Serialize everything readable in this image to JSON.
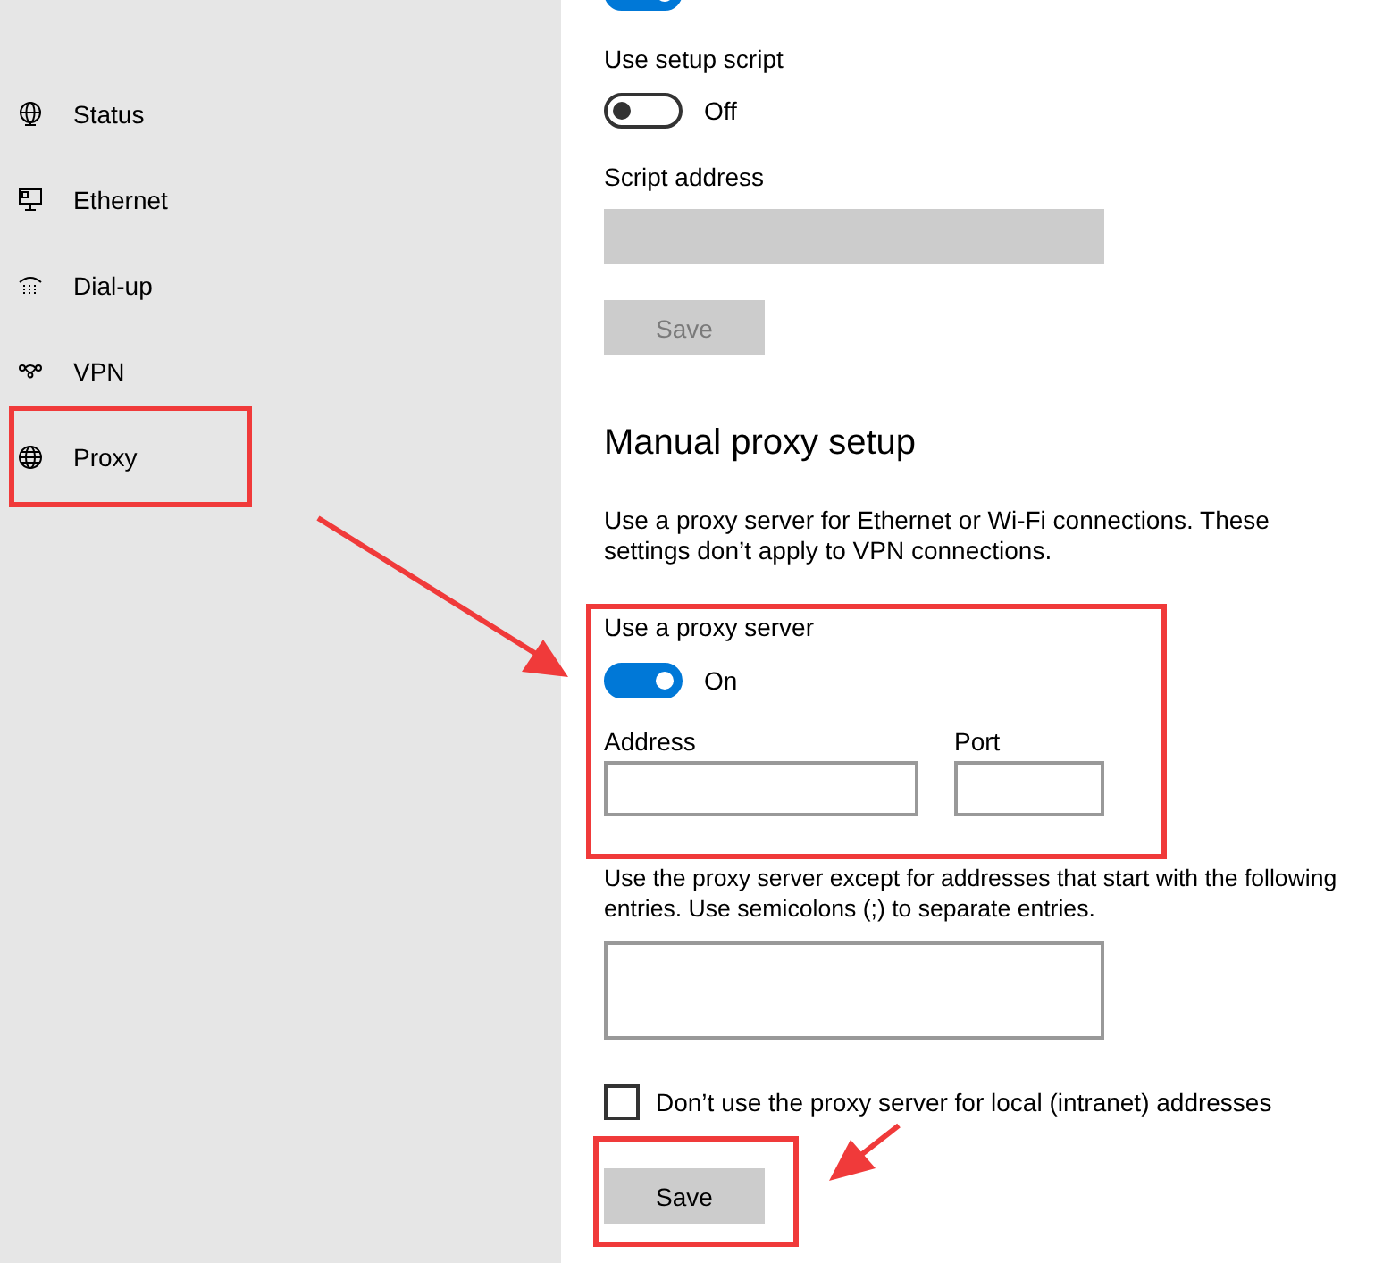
{
  "sidebar": {
    "items": [
      {
        "kind": "status",
        "label": "Status"
      },
      {
        "kind": "ethernet",
        "label": "Ethernet"
      },
      {
        "kind": "dialup",
        "label": "Dial-up"
      },
      {
        "kind": "vpn",
        "label": "VPN"
      },
      {
        "kind": "proxy",
        "label": "Proxy"
      }
    ]
  },
  "automatic": {
    "detect_toggle": {
      "on": true
    },
    "setup_script": {
      "label": "Use setup script",
      "on": false,
      "state_text": "Off"
    },
    "script_address": {
      "label": "Script address",
      "disabled": true
    },
    "save": {
      "label": "Save",
      "disabled": true
    }
  },
  "manual": {
    "heading": "Manual proxy setup",
    "description": "Use a proxy server for Ethernet or Wi-Fi connections. These settings don’t apply to VPN connections.",
    "use_proxy": {
      "label": "Use a proxy server",
      "on": true,
      "state_text": "On"
    },
    "address": {
      "label": "Address"
    },
    "port": {
      "label": "Port"
    },
    "exceptions": {
      "text": "Use the proxy server except for addresses that start with the following entries. Use semicolons (;) to separate entries."
    },
    "local_bypass": {
      "label": "Don’t use the proxy server for local (intranet) addresses",
      "checked": false
    },
    "save": {
      "label": "Save",
      "disabled": false
    }
  }
}
